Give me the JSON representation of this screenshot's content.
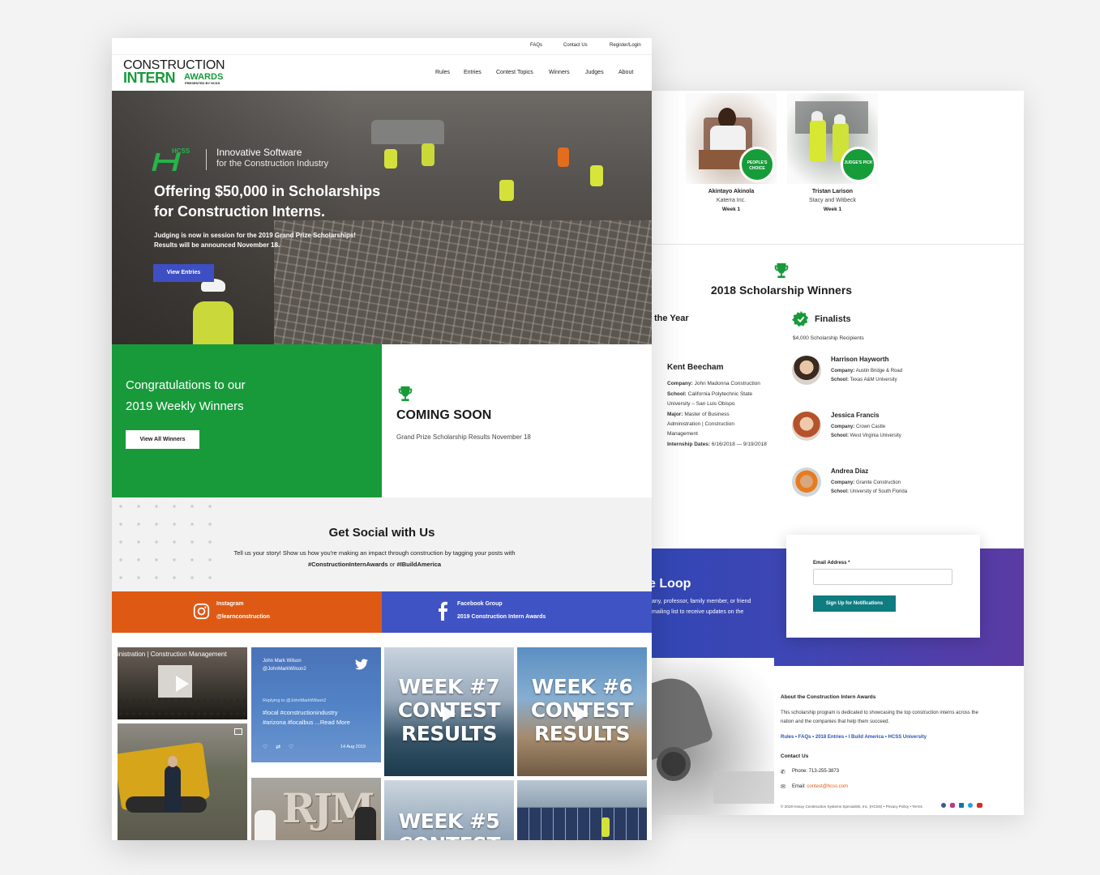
{
  "back_page": {
    "weekly_winners": [
      {
        "name": "Akintayo Akinola",
        "company": "Katerra Inc.",
        "week": "Week 1",
        "badge": "PEOPLE'S CHOICE"
      },
      {
        "name": "Tristan Larison",
        "company": "Stacy and Witbeck",
        "week": "Week 1",
        "badge": "JUDGE'S PICK"
      }
    ],
    "scholarship_title": "2018 Scholarship Winners",
    "of_the_year_fragment": "the Year",
    "kent": {
      "name": "Kent Beecham",
      "company_label": "Company:",
      "company": "John Madonna Construction",
      "school_label": "School:",
      "school_1": "California Polytechnic State",
      "school_2": "University – San Luis Obispo",
      "major_label": "Major:",
      "major_1": "Master of Business",
      "major_2": "Administration | Construction",
      "major_3": "Management",
      "dates_label": "Internship Dates:",
      "dates": "6/16/2018 — 9/19/2018"
    },
    "finalists_title": "Finalists",
    "finalists_sub": "$4,000 Scholarship Recipients",
    "finalists": [
      {
        "name": "Harrison Hayworth",
        "company_label": "Company:",
        "company": "Austin Bridge & Road",
        "school_label": "School:",
        "school": "Texas A&M University"
      },
      {
        "name": "Jessica Francis",
        "company_label": "Company:",
        "company": "Crown Castle",
        "school_label": "School:",
        "school": "West Virginia University"
      },
      {
        "name": "Andrea Diaz",
        "company_label": "Company:",
        "company": "Granite Construction",
        "school_label": "School:",
        "school": "University of South Florida"
      }
    ],
    "loop": {
      "title_fragment": "e Loop",
      "text_1": "any, professor, family member, or friend",
      "text_2": "mailing list to receive updates on the"
    },
    "signup": {
      "email_label": "Email Address *",
      "email_value": "",
      "button": "Sign Up for Notifications"
    },
    "footer": {
      "about_title": "About the Construction Intern Awards",
      "about_1": "This scholarship program is dedicated to showcasing the top construction interns across the",
      "about_2": "nation and the companies that help them succeed.",
      "links": "Rules • FAQs • 2018 Entries • I Build America • HCSS University",
      "contact_title": "Contact Us",
      "phone": "Phone: 713-255-3873",
      "email_label": "Email:",
      "email": "contest@hcss.com",
      "copyright": "© 2019 Heavy Construction Systems Specialists, Inc. (HCSS) • Privacy Policy • Terms",
      "social_icons": [
        "facebook-icon",
        "instagram-icon",
        "linkedin-icon",
        "twitter-icon",
        "youtube-icon"
      ]
    }
  },
  "front_page": {
    "util_nav": [
      "FAQs",
      "Contact Us",
      "Register/Login"
    ],
    "logo": {
      "line1": "CONSTRUCTION",
      "line2": "INTERN",
      "line3": "AWARDS",
      "line4": "PRESENTED BY HCSS"
    },
    "main_nav": [
      "Rules",
      "Entries",
      "Contest Topics",
      "Winners",
      "Judges",
      "About"
    ],
    "hero": {
      "brand_mark": "HCSS",
      "tagline_1": "Innovative Software",
      "tagline_2": "for the Construction Industry",
      "headline_1": "Offering $50,000 in Scholarships",
      "headline_2": "for Construction Interns.",
      "sub_1": "Judging is now in session for the 2019 Grand Prize Scholarships!",
      "sub_2": "Results will be announced November 18.",
      "cta": "View Entries"
    },
    "congrats": {
      "line1": "Congratulations to our",
      "line2": "2019 Weekly Winners",
      "button": "View All Winners"
    },
    "coming_soon": {
      "title": "COMING SOON",
      "text": "Grand Prize Scholarship Results November 18"
    },
    "social": {
      "title": "Get Social with Us",
      "text": "Tell us your story! Show us how you're making an impact through construction by tagging your posts with",
      "hashtag_1": "#ConstructionInternAwards",
      "or": "or",
      "hashtag_2": "#IBuildAmerica"
    },
    "instagram": {
      "label": "Instagram",
      "handle": "@learnconstruction"
    },
    "facebook": {
      "label": "Facebook Group",
      "group": "2019 Construction Intern Awards"
    },
    "tweet": {
      "name": "John Mark Wilson",
      "handle": "@JohnMarkWilson2",
      "reply": "Replying to @JohnMarkWilson2",
      "line1": "#local #constructionindustry",
      "line2": "#arizona #localbus ...Read More",
      "date": "14 Aug 2019"
    },
    "tile_caption": "inistration | Construction Management",
    "week7": [
      "WEEK #7",
      "CONTEST",
      "RESULTS"
    ],
    "week6": [
      "WEEK #6",
      "CONTEST",
      "RESULTS"
    ],
    "week5": [
      "WEEK #5",
      "CONTEST"
    ],
    "rjm": "RJM"
  },
  "colors": {
    "green": "#189a3a",
    "orange": "#de5a14",
    "blue": "#4053c4",
    "teal": "#0e7c80"
  }
}
